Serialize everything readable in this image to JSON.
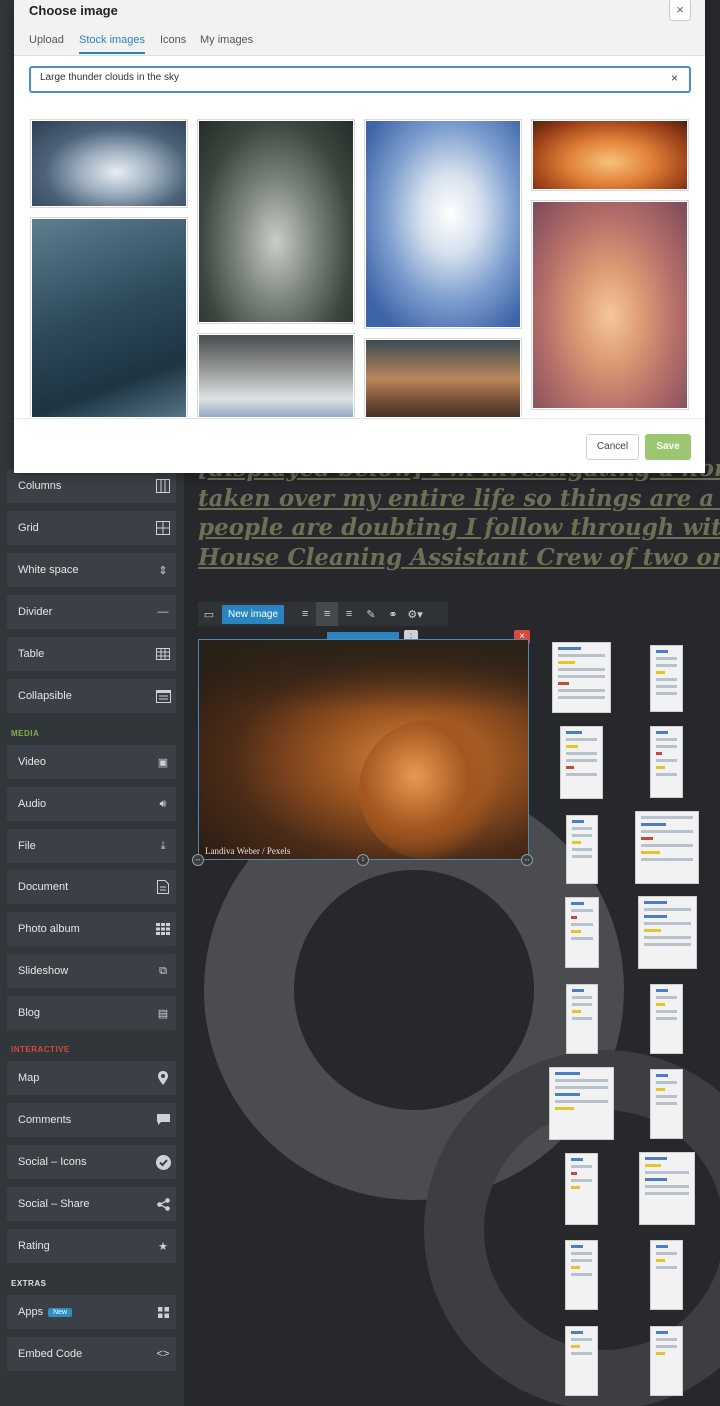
{
  "modal": {
    "title": "Choose image",
    "close": "×",
    "tabs": [
      {
        "label": "Upload"
      },
      {
        "label": "Stock images"
      },
      {
        "label": "Icons"
      },
      {
        "label": "My images"
      }
    ],
    "active_tab": "Stock images",
    "search": {
      "value": "Large thunder clouds in the sky",
      "clear": "×"
    },
    "cancel_label": "Cancel",
    "save_label": "Save",
    "photos": [
      {
        "name": "cloud-photo-1"
      },
      {
        "name": "cloud-photo-2"
      },
      {
        "name": "cloud-photo-3"
      },
      {
        "name": "cloud-photo-4"
      },
      {
        "name": "cloud-photo-5"
      },
      {
        "name": "cloud-photo-6"
      },
      {
        "name": "cloud-photo-7"
      },
      {
        "name": "cloud-photo-8"
      }
    ]
  },
  "sidebar": {
    "items_top": [
      {
        "label": "Columns",
        "icon": "columns-icon"
      },
      {
        "label": "Grid",
        "icon": "grid-icon"
      },
      {
        "label": "White space",
        "icon": "white-space-icon"
      },
      {
        "label": "Divider",
        "icon": "divider-icon"
      },
      {
        "label": "Table",
        "icon": "table-icon"
      },
      {
        "label": "Collapsible",
        "icon": "collapsible-icon"
      }
    ],
    "sections": {
      "media": "MEDIA",
      "interactive": "INTERACTIVE",
      "extras": "EXTRAS"
    },
    "media_items": [
      {
        "label": "Video",
        "icon": "video-icon"
      },
      {
        "label": "Audio",
        "icon": "audio-icon"
      },
      {
        "label": "File",
        "icon": "download-icon"
      },
      {
        "label": "Document",
        "icon": "document-icon"
      },
      {
        "label": "Photo album",
        "icon": "photo-album-icon"
      },
      {
        "label": "Slideshow",
        "icon": "slideshow-icon"
      },
      {
        "label": "Blog",
        "icon": "blog-icon"
      }
    ],
    "interactive_items": [
      {
        "label": "Map",
        "icon": "map-pin-icon"
      },
      {
        "label": "Comments",
        "icon": "comments-icon"
      },
      {
        "label": "Social – Icons",
        "icon": "check-circle-icon"
      },
      {
        "label": "Social – Share",
        "icon": "share-icon"
      },
      {
        "label": "Rating",
        "icon": "star-icon"
      }
    ],
    "extras_items": [
      {
        "label": "Apps",
        "badge": "New",
        "icon": "apps-icon"
      },
      {
        "label": "Embed Code",
        "icon": "code-icon"
      }
    ]
  },
  "editor": {
    "headline_lines": [
      "[displayed below] I'm investigating a homicide co",
      "taken over my entire life so things are a little diff",
      "people are doubting I follow through  with my pl",
      "House Cleaning Assistant Crew of two or more H"
    ],
    "toolbar": {
      "new_image_label": "New image"
    },
    "image_credit": "Landiva Weber / Pexels",
    "image_close": "×"
  },
  "colors": {
    "accent": "#2a84c0",
    "save": "#9cc772",
    "sidebar": "#31363b",
    "sidebar_item": "#3b4046",
    "danger": "#d9483b"
  }
}
